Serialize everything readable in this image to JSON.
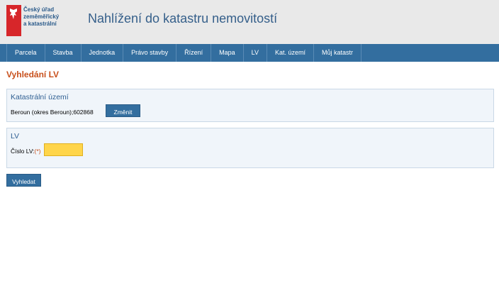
{
  "header": {
    "logo_lines": [
      "Český úřad",
      "zeměměřický",
      "a katastrální"
    ],
    "title": "Nahlížení do katastru nemovitostí"
  },
  "nav": {
    "items": [
      {
        "label": "Parcela"
      },
      {
        "label": "Stavba"
      },
      {
        "label": "Jednotka"
      },
      {
        "label": "Právo stavby"
      },
      {
        "label": "Řízení"
      },
      {
        "label": "Mapa"
      },
      {
        "label": "LV"
      },
      {
        "label": "Kat. území"
      },
      {
        "label": "Můj katastr"
      }
    ]
  },
  "page": {
    "title": "Vyhledání LV"
  },
  "cadastral_area": {
    "heading": "Katastrální území",
    "value": "Beroun (okres Beroun);602868",
    "change_button": "Změnit"
  },
  "lv": {
    "heading": "LV",
    "label": "Číslo LV:",
    "required_mark": "(*)",
    "input_value": ""
  },
  "search_button": "Vyhledat",
  "colors": {
    "accent": "#336e9f",
    "title": "#c8501c",
    "input_required": "#ffd54a",
    "logo_red": "#d7262a"
  }
}
